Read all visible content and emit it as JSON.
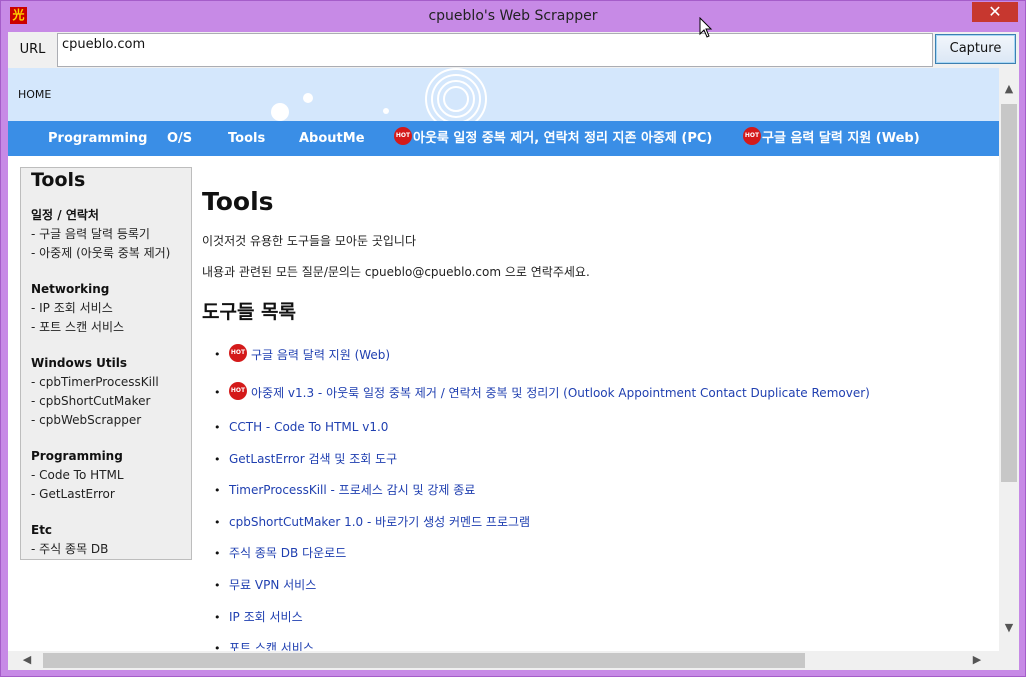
{
  "window": {
    "title": "cpueblo's Web Scrapper",
    "icon": "app-icon",
    "close_label": "✕"
  },
  "toolbar": {
    "url_label": "URL",
    "url_value": "cpueblo.com",
    "capture_label": "Capture"
  },
  "page": {
    "home": "HOME",
    "nav": [
      {
        "label": "Programming",
        "hot": false
      },
      {
        "label": "O/S",
        "hot": false
      },
      {
        "label": "Tools",
        "hot": false
      },
      {
        "label": "AboutMe",
        "hot": false
      },
      {
        "label": "아웃룩 일정 중복 제거, 연락처 정리 지존 아중제 (PC)",
        "hot": true
      },
      {
        "label": "구글 음력 달력 지원 (Web)",
        "hot": true
      }
    ],
    "hot_badge": "HOT",
    "sidebar": {
      "title": "Tools",
      "groups": [
        {
          "head": "일정 / 연락처",
          "links": [
            "- 구글 음력 달력 등록기",
            "- 아중제 (아웃룩 중복 제거)"
          ]
        },
        {
          "head": "Networking",
          "links": [
            "- IP 조회 서비스",
            "- 포트 스캔 서비스"
          ]
        },
        {
          "head": "Windows Utils",
          "links": [
            "- cpbTimerProcessKill",
            "- cpbShortCutMaker",
            "- cpbWebScrapper"
          ]
        },
        {
          "head": "Programming",
          "links": [
            "- Code To HTML",
            "- GetLastError"
          ]
        },
        {
          "head": "Etc",
          "links": [
            "- 주식 종목 DB"
          ]
        }
      ]
    },
    "main": {
      "title": "Tools",
      "intro": "이것저것 유용한 도구들을 모아둔 곳입니다",
      "contact": "내용과 관련된 모든 질문/문의는 cpueblo@cpueblo.com 으로 연락주세요.",
      "list_title": "도구들 목록",
      "items": [
        {
          "label": "구글 음력 달력 지원 (Web)",
          "hot": true
        },
        {
          "label": "아중제 v1.3 - 아웃룩 일정 중복 제거 / 연락처 중복 및 정리기 (Outlook Appointment Contact Duplicate Remover)",
          "hot": true
        },
        {
          "label": "CCTH - Code To HTML v1.0",
          "hot": false
        },
        {
          "label": "GetLastError 검색 및 조회 도구",
          "hot": false
        },
        {
          "label": "TimerProcessKill - 프로세스 감시 및 강제 종료",
          "hot": false
        },
        {
          "label": "cpbShortCutMaker 1.0 - 바로가기 생성 커멘드 프로그램",
          "hot": false
        },
        {
          "label": "주식 종목 DB 다운로드",
          "hot": false
        },
        {
          "label": "무료 VPN 서비스",
          "hot": false
        },
        {
          "label": "IP 조회 서비스",
          "hot": false
        },
        {
          "label": "포트 스캔 서비스",
          "hot": false
        }
      ]
    }
  },
  "colors": {
    "frame": "#c78ae6",
    "nav": "#3a8ee6",
    "banner": "#d4e7fc",
    "link": "#1f3fb0",
    "close": "#c7372f",
    "hot": "#d41a1a"
  }
}
